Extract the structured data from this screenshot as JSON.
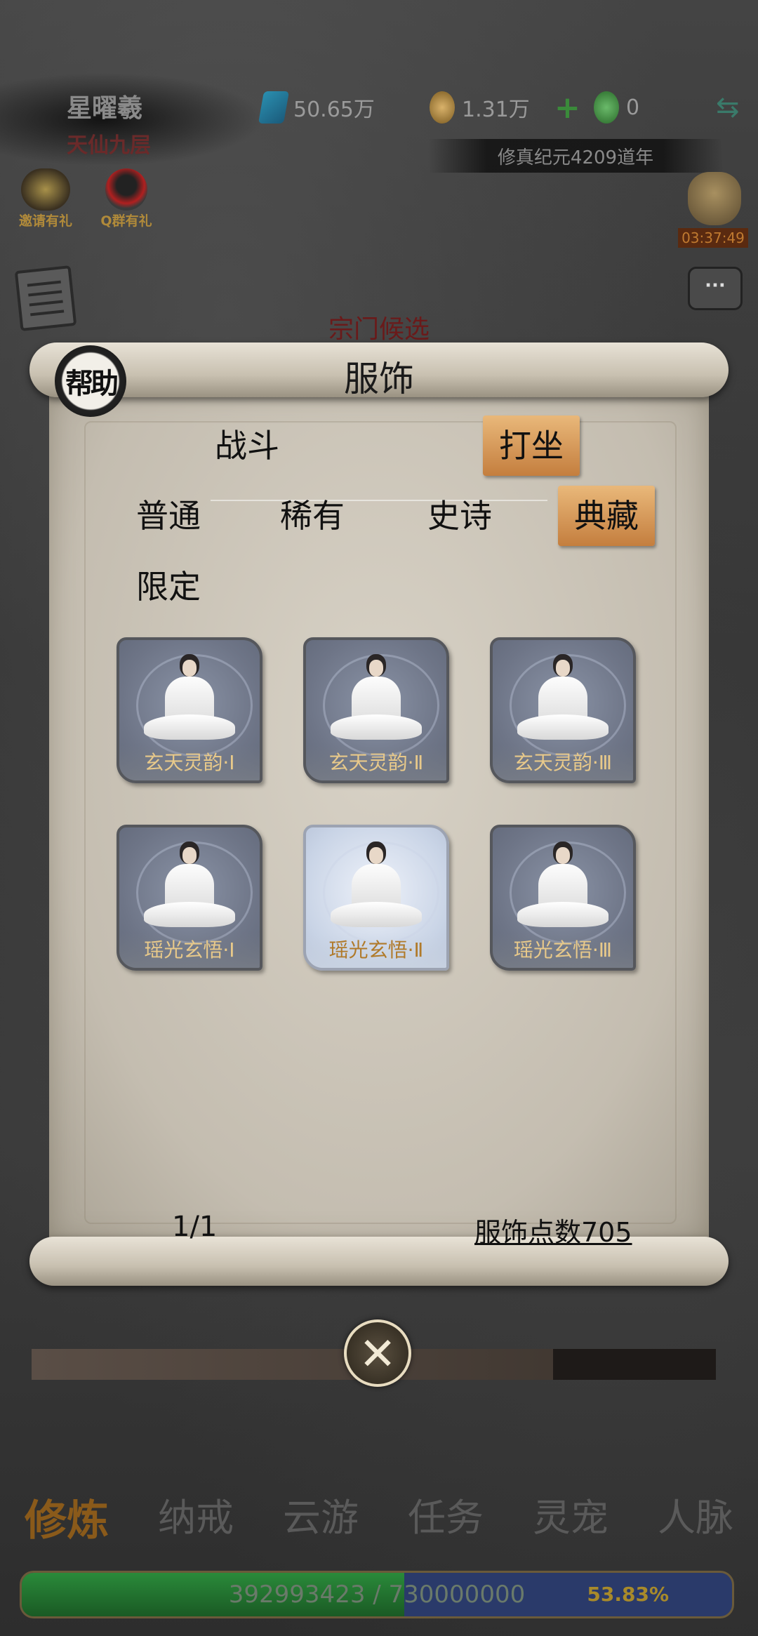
{
  "hud": {
    "player_name": "星曜羲",
    "realm": "天仙九层",
    "spirit_stones": "50.65万",
    "gold": "1.31万",
    "jade": "0",
    "era": "修真纪元4209道年",
    "timer": "03:37:49"
  },
  "shortcuts": [
    {
      "label": "邀请有礼",
      "icon": "invite-gift-icon"
    },
    {
      "label": "Q群有礼",
      "icon": "qq-penguin-icon"
    }
  ],
  "background_title": "宗门候选",
  "modal": {
    "help_label": "帮助",
    "title": "服饰",
    "category_tabs": [
      {
        "label": "战斗",
        "selected": false
      },
      {
        "label": "打坐",
        "selected": true
      }
    ],
    "rarity_tabs": [
      {
        "label": "普通",
        "selected": false
      },
      {
        "label": "稀有",
        "selected": false
      },
      {
        "label": "史诗",
        "selected": false
      },
      {
        "label": "典藏",
        "selected": true
      },
      {
        "label": "限定",
        "selected": false
      }
    ],
    "items": [
      {
        "name": "玄天灵韵·Ⅰ",
        "selected": false
      },
      {
        "name": "玄天灵韵·Ⅱ",
        "selected": false
      },
      {
        "name": "玄天灵韵·Ⅲ",
        "selected": false
      },
      {
        "name": "瑶光玄悟·Ⅰ",
        "selected": false
      },
      {
        "name": "瑶光玄悟·Ⅱ",
        "selected": true
      },
      {
        "name": "瑶光玄悟·Ⅲ",
        "selected": false
      }
    ],
    "page": "1/1",
    "points_label": "服饰点数705"
  },
  "bottom_nav": [
    {
      "label": "修炼",
      "active": true
    },
    {
      "label": "纳戒",
      "active": false
    },
    {
      "label": "云游",
      "active": false
    },
    {
      "label": "任务",
      "active": false
    },
    {
      "label": "灵宠",
      "active": false
    },
    {
      "label": "人脉",
      "active": false
    }
  ],
  "experience": {
    "text": "392993423 / 730000000",
    "percent_label": "53.83%",
    "fraction": 0.5383
  },
  "colors": {
    "selected_tab": "#d99a55",
    "paper": "#cfc8bb",
    "item_label": "#e8c98a"
  }
}
